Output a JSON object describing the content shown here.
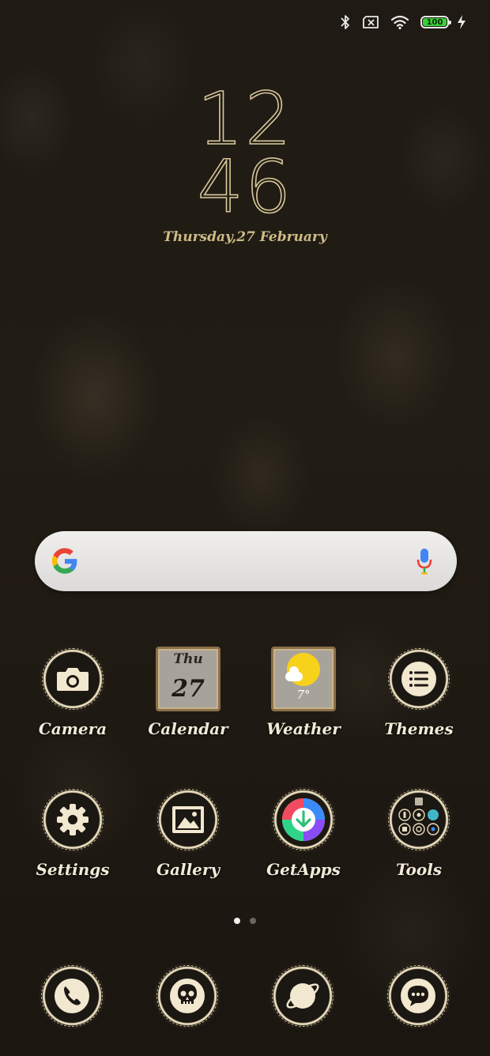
{
  "status_bar": {
    "icons": [
      "bluetooth-icon",
      "no-sim-icon",
      "wifi-icon",
      "battery-icon",
      "charging-icon"
    ],
    "battery_level": "100",
    "battery_fraction": 1.0,
    "battery_color": "#3ccf3c"
  },
  "clock": {
    "hours": "12",
    "minutes": "46",
    "date": "Thursday,27 February",
    "color": "#d8c79a"
  },
  "search": {
    "logo": "google-g-icon",
    "mic": "microphone-icon",
    "placeholder": ""
  },
  "apps": {
    "camera": {
      "label": "Camera",
      "icon": "camera-icon"
    },
    "calendar": {
      "label": "Calendar",
      "icon": "calendar-icon",
      "day": "Thu",
      "date": "27"
    },
    "weather": {
      "label": "Weather",
      "icon": "weather-icon",
      "temp": "7°"
    },
    "themes": {
      "label": "Themes",
      "icon": "themes-icon"
    },
    "settings": {
      "label": "Settings",
      "icon": "gear-icon"
    },
    "gallery": {
      "label": "Gallery",
      "icon": "image-icon"
    },
    "getapps": {
      "label": "GetApps",
      "icon": "getapps-icon"
    },
    "tools": {
      "label": "Tools",
      "icon": "folder-icon"
    }
  },
  "page_indicator": {
    "pages": 2,
    "current": 1
  },
  "dock": [
    {
      "icon": "phone-icon"
    },
    {
      "icon": "skull-icon"
    },
    {
      "icon": "browser-icon"
    },
    {
      "icon": "messages-icon"
    }
  ],
  "colors": {
    "accent": "#d8c79a",
    "ring": "#e9dcbc",
    "label": "#f2ead8"
  }
}
